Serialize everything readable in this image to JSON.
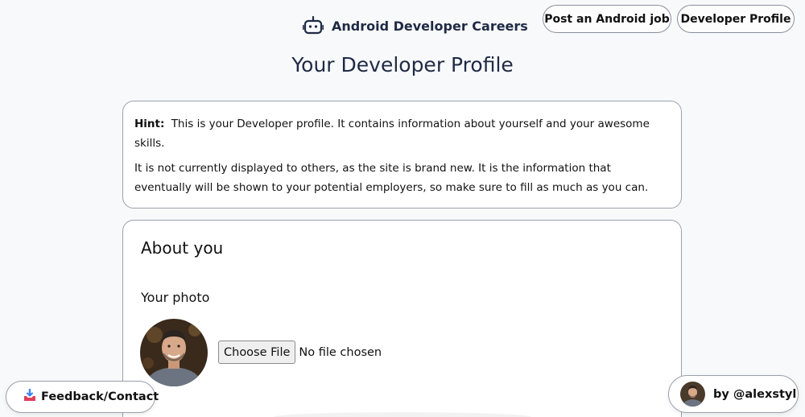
{
  "header": {
    "brand_label": "Android Developer Careers",
    "brand_icon": "android-robot-icon",
    "nav": [
      {
        "label": "Post an Android job"
      },
      {
        "label": "Developer Profile"
      }
    ]
  },
  "page": {
    "title": "Your Developer Profile"
  },
  "hint": {
    "label": "Hint:",
    "line1": "This is your Developer profile. It contains information about yourself and your awesome skills.",
    "line2": "It is not currently displayed to others, as the site is brand new. It is the information that eventually will be shown to your potential employers, so make sure to fill as much as you can."
  },
  "about": {
    "title": "About you",
    "photo_label": "Your photo",
    "file_button": "Choose File",
    "file_status": "No file chosen"
  },
  "footer": {
    "feedback_icon": "inbox-tray-icon",
    "feedback_label": "Feedback/Contact",
    "credit_label": "by @alexstyl"
  },
  "colors": {
    "background": "#f8f9fa",
    "border": "#9aa0ab",
    "heading": "#1f2a44"
  }
}
